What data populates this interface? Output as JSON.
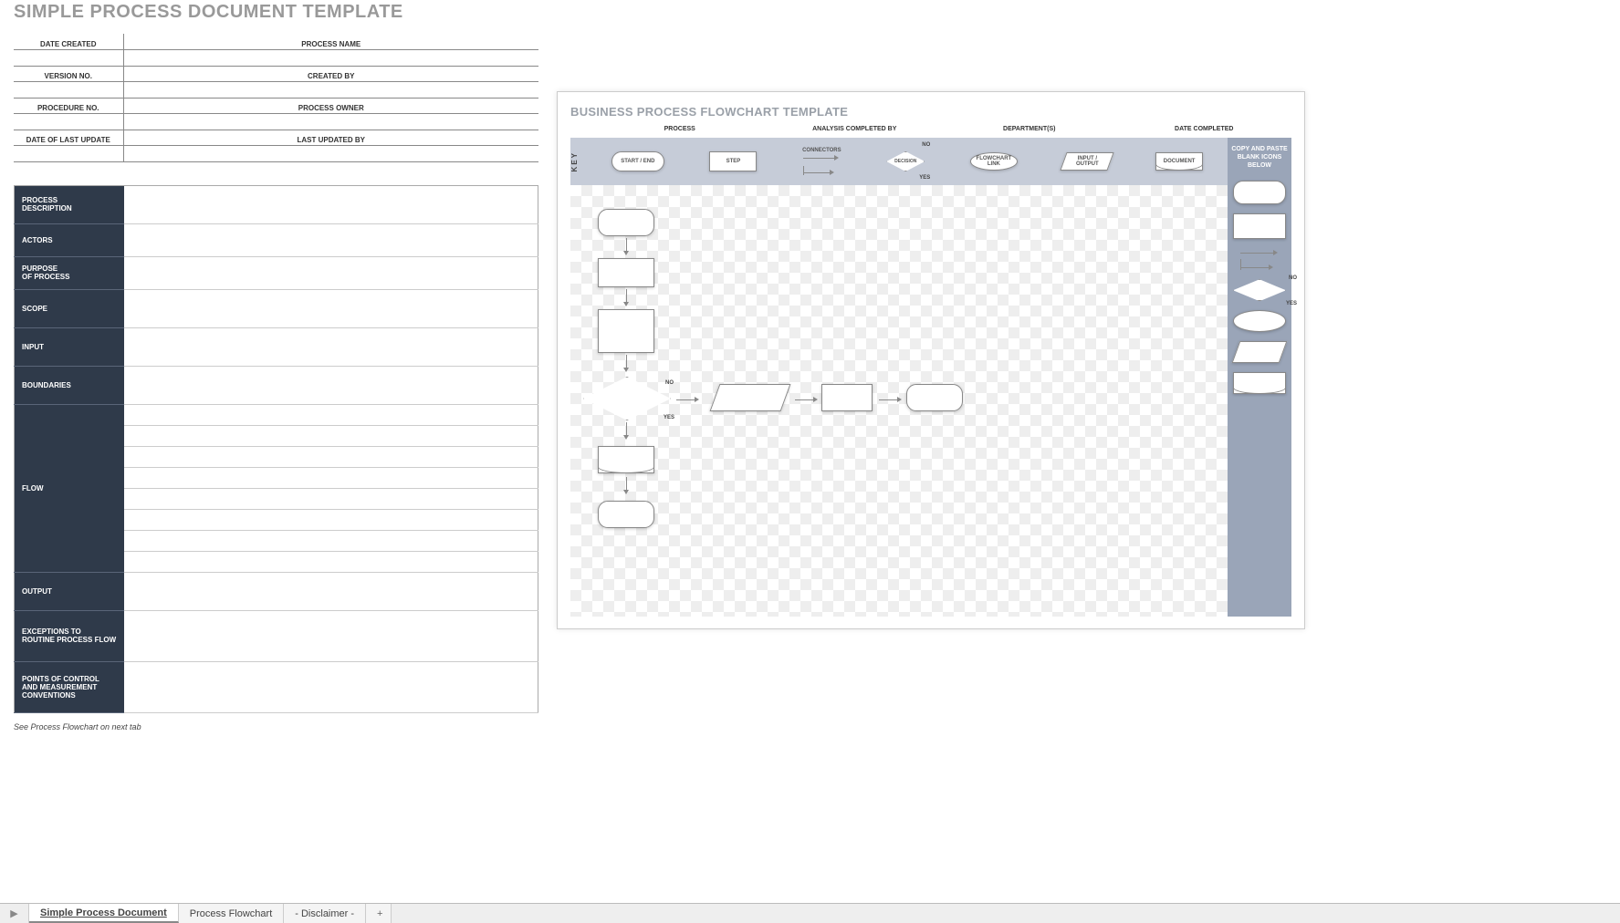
{
  "left": {
    "title": "SIMPLE PROCESS DOCUMENT TEMPLATE",
    "meta": [
      {
        "a": "DATE CREATED",
        "b": "PROCESS NAME"
      },
      {
        "a": "VERSION NO.",
        "b": "CREATED BY"
      },
      {
        "a": "PROCEDURE NO.",
        "b": "PROCESS OWNER"
      },
      {
        "a": "DATE OF LAST UPDATE",
        "b": "LAST UPDATED BY"
      }
    ],
    "sections": [
      {
        "label": "PROCESS\nDESCRIPTION",
        "rows": 1,
        "h": "h42"
      },
      {
        "label": "ACTORS",
        "rows": 1,
        "h": "h36"
      },
      {
        "label": "PURPOSE\nOF PROCESS",
        "rows": 1,
        "h": "h36"
      },
      {
        "label": "SCOPE",
        "rows": 1,
        "h": "h42"
      },
      {
        "label": "INPUT",
        "rows": 1,
        "h": "h42"
      },
      {
        "label": "BOUNDARIES",
        "rows": 1,
        "h": "h42"
      },
      {
        "label": "FLOW",
        "rows": 8,
        "h": "h23"
      },
      {
        "label": "OUTPUT",
        "rows": 1,
        "h": "h42"
      },
      {
        "label": "EXCEPTIONS TO\nROUTINE PROCESS FLOW",
        "rows": 1,
        "h": "h56"
      },
      {
        "label": "POINTS OF CONTROL\nAND MEASUREMENT\nCONVENTIONS",
        "rows": 1,
        "h": "h56"
      }
    ],
    "footnote": "See Process Flowchart on next tab"
  },
  "right": {
    "title": "BUSINESS PROCESS FLOWCHART TEMPLATE",
    "meta": [
      "PROCESS",
      "ANALYSIS COMPLETED BY",
      "DEPARTMENT(S)",
      "DATE COMPLETED"
    ],
    "key_label": "KEY",
    "key_items": [
      {
        "shape": "terminator",
        "label": "START / END"
      },
      {
        "shape": "process-box",
        "label": "STEP"
      },
      {
        "shape": "connector-line",
        "label": "CONNECTORS"
      },
      {
        "shape": "diamond",
        "label": "DECISION",
        "no": "NO",
        "yes": "YES"
      },
      {
        "shape": "oval",
        "label": "FLOWCHART\nLINK"
      },
      {
        "shape": "parallelogram",
        "label": "INPUT /\nOUTPUT"
      },
      {
        "shape": "doc-shape",
        "label": "DOCUMENT"
      }
    ],
    "side_title": "COPY AND PASTE BLANK ICONS BELOW",
    "canvas_decision": {
      "no": "NO",
      "yes": "YES"
    },
    "side_decision": {
      "no": "NO",
      "yes": "YES"
    }
  },
  "tabs": {
    "scroll": "▶",
    "items": [
      {
        "label": "Simple Process Document",
        "active": true
      },
      {
        "label": "Process Flowchart",
        "active": false
      },
      {
        "label": "- Disclaimer -",
        "active": false
      }
    ],
    "add": "+"
  }
}
